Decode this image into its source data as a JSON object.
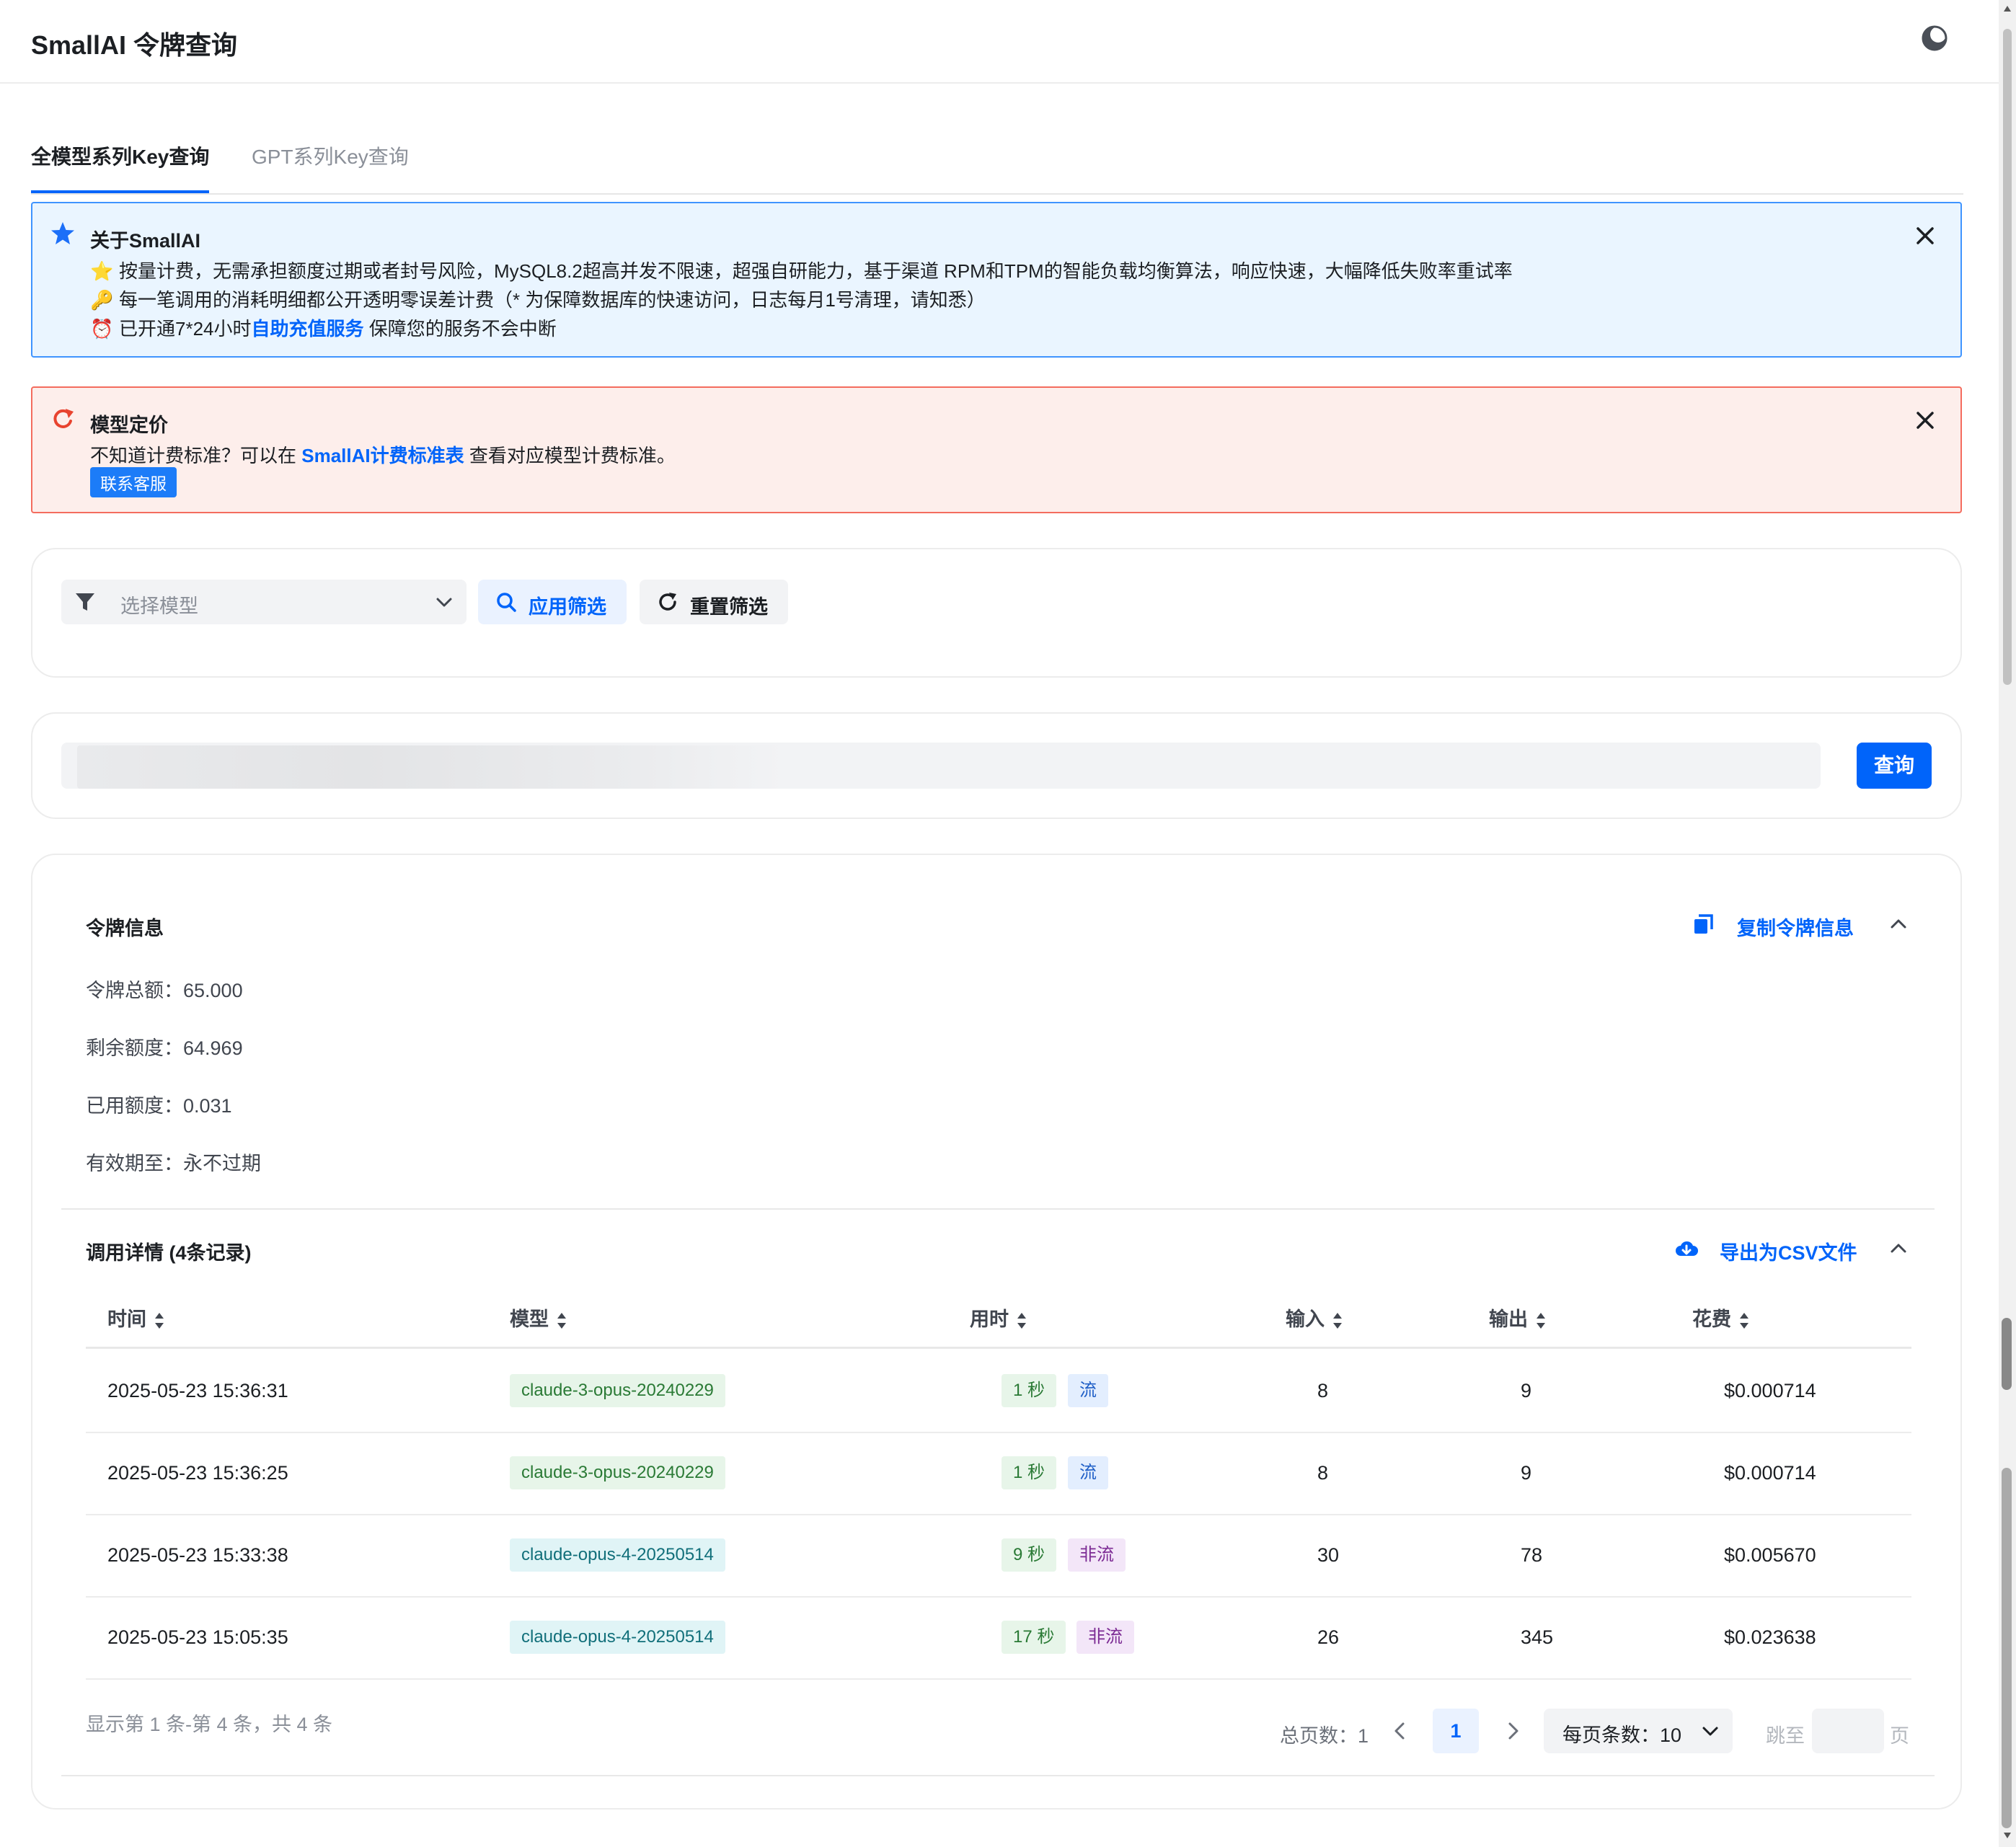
{
  "app": {
    "title": "SmallAI 令牌查询",
    "theme_icon": "moon-icon"
  },
  "tabs": [
    {
      "label": "全模型系列Key查询",
      "active": true
    },
    {
      "label": "GPT系列Key查询",
      "active": false
    }
  ],
  "banner_info": {
    "title": "关于SmallAI",
    "icon": "star-icon",
    "line1_emoji": "⭐",
    "line1": "按量计费，无需承担额度过期或者封号风险，MySQL8.2超高并发不限速，超强自研能力，基于渠道 RPM和TPM的智能负载均衡算法，响应快速，大幅降低失败率重试率",
    "line2_emoji": "🔑",
    "line2": "每一笔调用的消耗明细都公开透明零误差计费（* 为保障数据库的快速访问，日志每月1号清理，请知悉）",
    "line3_emoji": "⏰",
    "line3_pre": "已开通7*24小时",
    "line3_link": "自助充值服务",
    "line3_post": " 保障您的服务不会中断"
  },
  "banner_warn": {
    "title": "模型定价",
    "icon": "redo-icon",
    "text_pre": "不知道计费标准？可以在 ",
    "text_link": "SmallAI计费标准表",
    "text_post": " 查看对应模型计费标准。",
    "contact": "联系客服"
  },
  "filter": {
    "placeholder": "选择模型",
    "apply": "应用筛选",
    "reset": "重置筛选"
  },
  "query": {
    "button": "查询"
  },
  "token_info": {
    "title": "令牌信息",
    "copy": "复制令牌信息",
    "total_label": "令牌总额：",
    "total": "65.000",
    "remain_label": "剩余额度：",
    "remain": "64.969",
    "used_label": "已用额度：",
    "used": "0.031",
    "expire_label": "有效期至：",
    "expire": "永不过期"
  },
  "calls": {
    "title": "调用详情 (4条记录)",
    "export": "导出为CSV文件",
    "headers": [
      "时间",
      "模型",
      "用时",
      "输入",
      "输出",
      "花费"
    ],
    "rows": [
      {
        "time": "2025-05-23 15:36:31",
        "model": "claude-3-opus-20240229",
        "duration": "1 秒",
        "mode": "流",
        "input": "8",
        "output": "9",
        "cost": "$0.000714"
      },
      {
        "time": "2025-05-23 15:36:25",
        "model": "claude-3-opus-20240229",
        "duration": "1 秒",
        "mode": "流",
        "input": "8",
        "output": "9",
        "cost": "$0.000714"
      },
      {
        "time": "2025-05-23 15:33:38",
        "model": "claude-opus-4-20250514",
        "duration": "9 秒",
        "mode": "非流",
        "input": "30",
        "output": "78",
        "cost": "$0.005670"
      },
      {
        "time": "2025-05-23 15:05:35",
        "model": "claude-opus-4-20250514",
        "duration": "17 秒",
        "mode": "非流",
        "input": "26",
        "output": "345",
        "cost": "$0.023638"
      }
    ],
    "footer": "显示第 1 条-第 4 条，共 4 条",
    "total_pages": "总页数：1",
    "current_page": "1",
    "page_size": "每页条数：10",
    "jump_to": "跳至",
    "page_unit": "页"
  }
}
